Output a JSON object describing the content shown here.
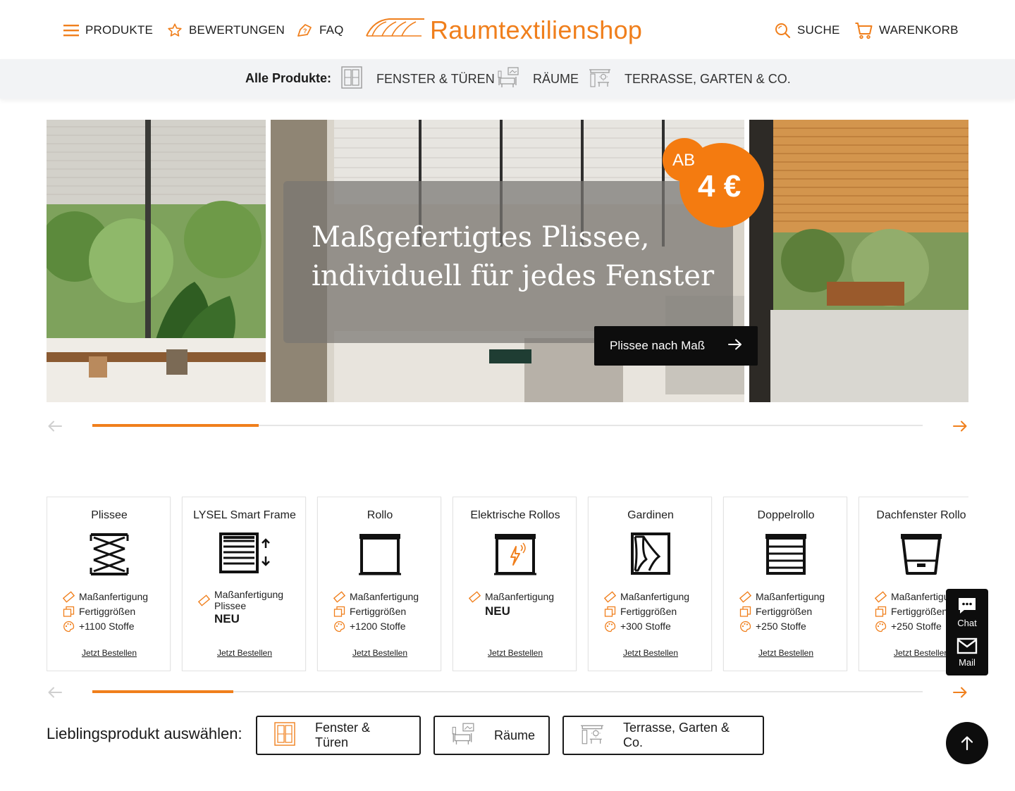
{
  "header": {
    "nav_left": [
      {
        "label": "PRODUKTE",
        "icon": "menu-icon"
      },
      {
        "label": "BEWERTUNGEN",
        "icon": "star-icon"
      },
      {
        "label": "FAQ",
        "icon": "faq-icon"
      }
    ],
    "logo_text": "Raumtextilienshop",
    "nav_right": [
      {
        "label": "SUCHE",
        "icon": "search-icon"
      },
      {
        "label": "WARENKORB",
        "icon": "cart-icon"
      }
    ],
    "accent_color": "#f07f1c"
  },
  "category_bar": {
    "label": "Alle Produkte:",
    "items": [
      {
        "label": "FENSTER & TÜREN",
        "icon": "window-door-icon"
      },
      {
        "label": "RÄUME",
        "icon": "room-icon"
      },
      {
        "label": "TERRASSE, GARTEN & CO.",
        "icon": "terrace-icon"
      }
    ]
  },
  "hero": {
    "title_line1": "Maßgefertigtes Plissee,",
    "title_line2": "individuell für jedes Fenster",
    "badge_prefix": "AB",
    "badge_price": "4 €",
    "cta_label": "Plissee nach Maß",
    "progress": 0.2
  },
  "products": [
    {
      "title": "Plissee",
      "icon": "plissee-icon",
      "features": [
        "Maßanfertigung",
        "Fertiggrößen",
        "+1100 Stoffe"
      ],
      "badge": "",
      "link": "Jetzt Bestellen"
    },
    {
      "title": "LYSEL Smart Frame",
      "icon": "smart-frame-icon",
      "features": [
        "Maßanfertigung Plissee"
      ],
      "badge": "NEU",
      "link": "Jetzt Bestellen"
    },
    {
      "title": "Rollo",
      "icon": "rollo-icon",
      "features": [
        "Maßanfertigung",
        "Fertiggrößen",
        "+1200 Stoffe"
      ],
      "badge": "",
      "link": "Jetzt Bestellen"
    },
    {
      "title": "Elektrische Rollos",
      "icon": "electric-rollo-icon",
      "features": [
        "Maßanfertigung"
      ],
      "badge": "NEU",
      "link": "Jetzt Bestellen"
    },
    {
      "title": "Gardinen",
      "icon": "curtain-icon",
      "features": [
        "Maßanfertigung",
        "Fertiggrößen",
        "+300 Stoffe"
      ],
      "badge": "",
      "link": "Jetzt Bestellen"
    },
    {
      "title": "Doppelrollo",
      "icon": "double-rollo-icon",
      "features": [
        "Maßanfertigung",
        "Fertiggrößen",
        "+250 Stoffe"
      ],
      "badge": "",
      "link": "Jetzt Bestellen"
    },
    {
      "title": "Dachfenster Rollo",
      "icon": "roof-window-rollo-icon",
      "features": [
        "Maßanfertigung",
        "Fertiggrößen",
        "+250 Stoffe"
      ],
      "badge": "",
      "link": "Jetzt Bestellen"
    }
  ],
  "products_progress": 0.17,
  "favorites": {
    "label": "Lieblingsprodukt auswählen:",
    "buttons": [
      {
        "label": "Fenster & Türen",
        "icon": "window-door-icon"
      },
      {
        "label": "Räume",
        "icon": "room-icon"
      },
      {
        "label": "Terrasse, Garten & Co.",
        "icon": "terrace-icon"
      }
    ]
  },
  "contact_widget": {
    "chat_label": "Chat",
    "mail_label": "Mail"
  }
}
